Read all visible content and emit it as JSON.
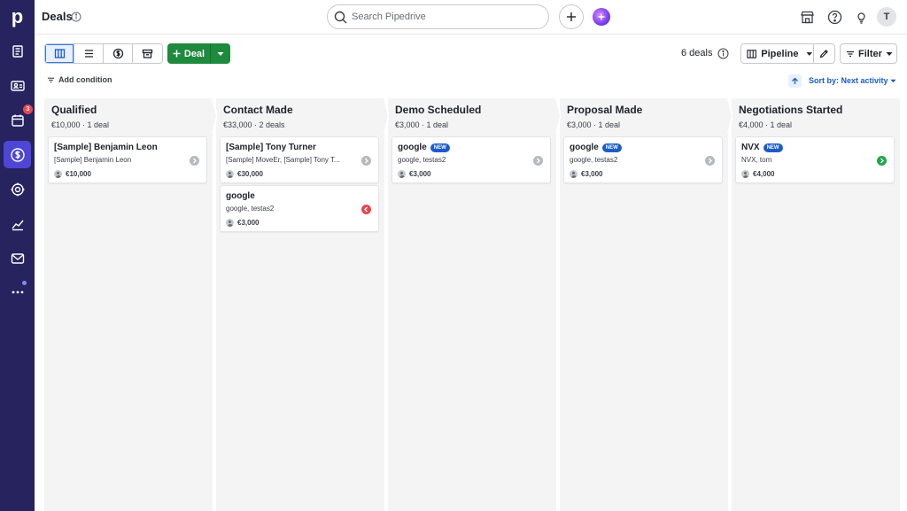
{
  "rail": {
    "logo": "p",
    "activity_badge": "3",
    "items": [
      {
        "name": "leads-icon"
      },
      {
        "name": "contacts-icon"
      },
      {
        "name": "activities-icon"
      },
      {
        "name": "deals-icon"
      },
      {
        "name": "projects-icon"
      },
      {
        "name": "insights-icon"
      },
      {
        "name": "mail-icon"
      },
      {
        "name": "more-icon"
      }
    ]
  },
  "header": {
    "title": "Deals",
    "search_placeholder": "Search Pipedrive",
    "avatar_initial": "T"
  },
  "toolbar": {
    "views": [
      "pipeline-view",
      "list-view",
      "forecast-view",
      "archive-view"
    ],
    "deal_label": "Deal",
    "deal_count": "6 deals",
    "pipeline_label": "Pipeline",
    "filter_label": "Filter"
  },
  "subbar": {
    "add_condition": "Add condition",
    "sort_label": "Sort by: Next activity"
  },
  "colors": {
    "rail": "#26235e",
    "rail_active": "#4e46d6",
    "primary": "#1e8a3e",
    "link": "#1a5cc8",
    "column_bg": "#f4f4f5"
  },
  "columns": [
    {
      "title": "Qualified",
      "sum": "€10,000 · 1 deal",
      "cards": [
        {
          "title": "[Sample] Benjamin Leon",
          "is_new": false,
          "sub": "[Sample] Benjamin Leon",
          "value": "€10,000",
          "status": "grey"
        }
      ]
    },
    {
      "title": "Contact Made",
      "sum": "€33,000 · 2 deals",
      "cards": [
        {
          "title": "[Sample] Tony Turner",
          "is_new": false,
          "sub": "[Sample] MoveEr, [Sample] Tony T...",
          "value": "€30,000",
          "status": "grey"
        },
        {
          "title": "google",
          "is_new": false,
          "sub": "google, testas2",
          "value": "€3,000",
          "status": "red"
        }
      ]
    },
    {
      "title": "Demo Scheduled",
      "sum": "€3,000 · 1 deal",
      "cards": [
        {
          "title": "google",
          "is_new": true,
          "new_label": "NEW",
          "sub": "google, testas2",
          "value": "€3,000",
          "status": "grey"
        }
      ]
    },
    {
      "title": "Proposal Made",
      "sum": "€3,000 · 1 deal",
      "cards": [
        {
          "title": "google",
          "is_new": true,
          "new_label": "NEW",
          "sub": "google, testas2",
          "value": "€3,000",
          "status": "grey"
        }
      ]
    },
    {
      "title": "Negotiations Started",
      "sum": "€4,000 · 1 deal",
      "cards": [
        {
          "title": "NVX",
          "is_new": true,
          "new_label": "NEW",
          "sub": "NVX, tom",
          "value": "€4,000",
          "status": "green"
        }
      ]
    }
  ]
}
